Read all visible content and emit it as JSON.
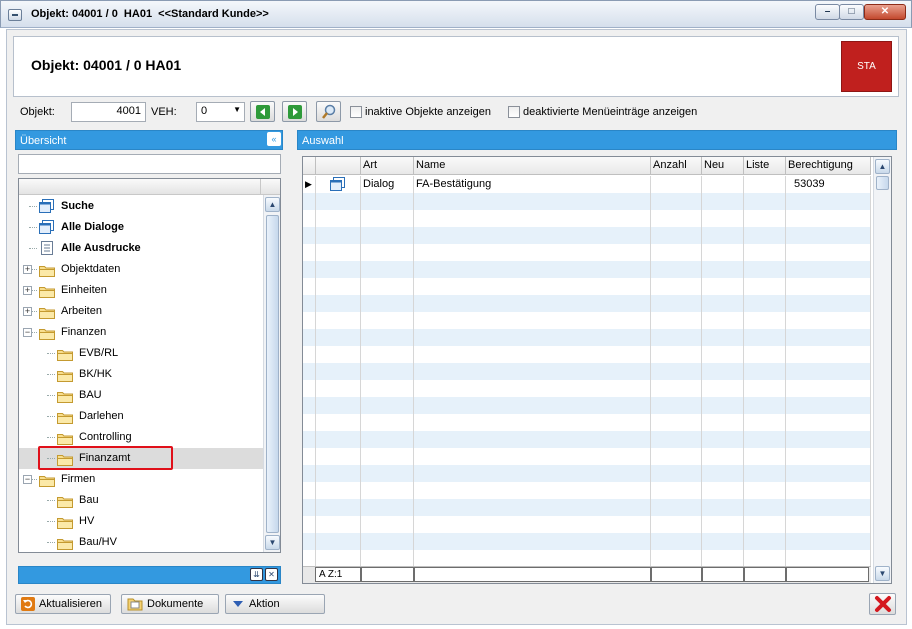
{
  "window": {
    "title": "Objekt: 04001 / 0  HA01  <<Standard Kunde>>"
  },
  "header": {
    "title": "Objekt: 04001 / 0  HA01",
    "badge": "STA"
  },
  "toolbar": {
    "objekt_label": "Objekt:",
    "objekt_value": "4001",
    "veh_label": "VEH:",
    "veh_value": "0",
    "inactive_label": "inaktive Objekte anzeigen",
    "deactivated_label": "deaktivierte Menüeinträge anzeigen"
  },
  "overview": {
    "title": "Übersicht",
    "search_value": "",
    "items": [
      {
        "label": "Suche",
        "bold": true,
        "icon": "dialog-icon",
        "level": 0,
        "expander": ""
      },
      {
        "label": "Alle Dialoge",
        "bold": true,
        "icon": "dialog-icon",
        "level": 0,
        "expander": ""
      },
      {
        "label": "Alle Ausdrucke",
        "bold": true,
        "icon": "report-icon",
        "level": 0,
        "expander": ""
      },
      {
        "label": "Objektdaten",
        "bold": false,
        "icon": "folder-icon",
        "level": 0,
        "expander": "+"
      },
      {
        "label": "Einheiten",
        "bold": false,
        "icon": "folder-icon",
        "level": 0,
        "expander": "+"
      },
      {
        "label": "Arbeiten",
        "bold": false,
        "icon": "folder-icon",
        "level": 0,
        "expander": "+"
      },
      {
        "label": "Finanzen",
        "bold": false,
        "icon": "folder-icon",
        "level": 0,
        "expander": "−"
      },
      {
        "label": "EVB/RL",
        "bold": false,
        "icon": "folder-icon",
        "level": 1,
        "expander": ""
      },
      {
        "label": "BK/HK",
        "bold": false,
        "icon": "folder-icon",
        "level": 1,
        "expander": ""
      },
      {
        "label": "BAU",
        "bold": false,
        "icon": "folder-icon",
        "level": 1,
        "expander": ""
      },
      {
        "label": "Darlehen",
        "bold": false,
        "icon": "folder-icon",
        "level": 1,
        "expander": ""
      },
      {
        "label": "Controlling",
        "bold": false,
        "icon": "folder-icon",
        "level": 1,
        "expander": ""
      },
      {
        "label": "Finanzamt",
        "bold": false,
        "icon": "folder-icon",
        "level": 1,
        "expander": "",
        "selected": true
      },
      {
        "label": "Firmen",
        "bold": false,
        "icon": "folder-icon",
        "level": 0,
        "expander": "−"
      },
      {
        "label": "Bau",
        "bold": false,
        "icon": "folder-icon",
        "level": 1,
        "expander": ""
      },
      {
        "label": "HV",
        "bold": false,
        "icon": "folder-icon",
        "level": 1,
        "expander": ""
      },
      {
        "label": "Bau/HV",
        "bold": false,
        "icon": "folder-icon",
        "level": 1,
        "expander": ""
      }
    ]
  },
  "selection": {
    "title": "Auswahl",
    "columns": [
      "Art",
      "Name",
      "Anzahl",
      "Neu",
      "Liste",
      "Berechtigung"
    ],
    "rows": [
      {
        "art": "Dialog",
        "name": "FA-Bestätigung",
        "anzahl": "",
        "neu": "",
        "liste": "",
        "berechtigung": "53039"
      }
    ],
    "footer_sort": "A  Z:1"
  },
  "bottom": {
    "refresh_label": "Aktualisieren",
    "documents_label": "Dokumente",
    "action_label": "Aktion"
  },
  "colors": {
    "accent": "#3399e0",
    "badge": "#c0201e",
    "row_alt": "#e6f1fa",
    "highlight": "#e0101a"
  }
}
